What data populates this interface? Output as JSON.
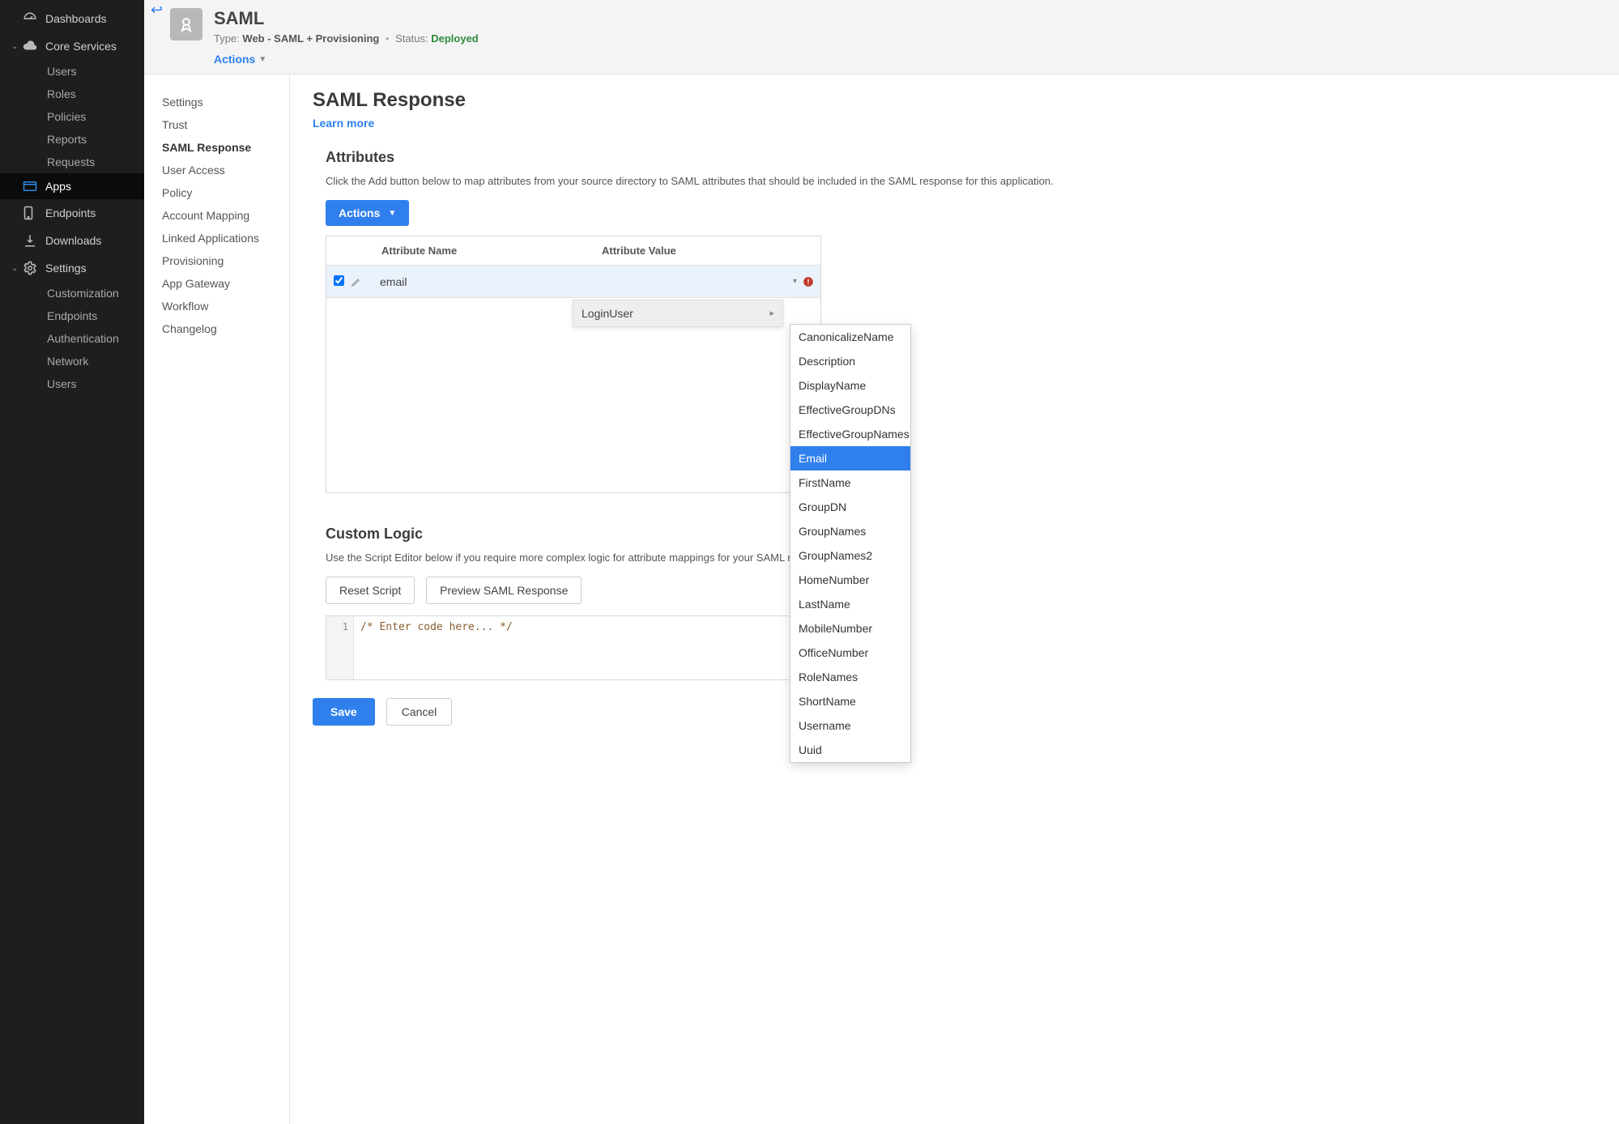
{
  "nav": {
    "dashboards": "Dashboards",
    "core_services": "Core Services",
    "core_items": [
      "Users",
      "Roles",
      "Policies",
      "Reports",
      "Requests"
    ],
    "apps": "Apps",
    "endpoints": "Endpoints",
    "downloads": "Downloads",
    "settings": "Settings",
    "settings_items": [
      "Customization",
      "Endpoints",
      "Authentication",
      "Network",
      "Users"
    ]
  },
  "header": {
    "title": "SAML",
    "type_label": "Type:",
    "type_value": "Web - SAML + Provisioning",
    "status_label": "Status:",
    "status_value": "Deployed",
    "actions": "Actions"
  },
  "sec_nav": [
    "Settings",
    "Trust",
    "SAML Response",
    "User Access",
    "Policy",
    "Account Mapping",
    "Linked Applications",
    "Provisioning",
    "App Gateway",
    "Workflow",
    "Changelog"
  ],
  "sec_nav_active": 2,
  "page": {
    "title": "SAML Response",
    "learn_more": "Learn more",
    "attributes_heading": "Attributes",
    "attributes_desc": "Click the Add button below to map attributes from your source directory to SAML attributes that should be included in the SAML response for this application.",
    "actions_btn": "Actions",
    "table": {
      "col_name": "Attribute Name",
      "col_value": "Attribute Value",
      "row_name": "email"
    },
    "dropdown": {
      "parent": "LoginUser",
      "options": [
        "CanonicalizeName",
        "Description",
        "DisplayName",
        "EffectiveGroupDNs",
        "EffectiveGroupNames",
        "Email",
        "FirstName",
        "GroupDN",
        "GroupNames",
        "GroupNames2",
        "HomeNumber",
        "LastName",
        "MobileNumber",
        "OfficeNumber",
        "RoleNames",
        "ShortName",
        "Username",
        "Uuid"
      ],
      "selected": "Email"
    },
    "custom_heading": "Custom Logic",
    "custom_desc": "Use the Script Editor below if you require more complex logic for attribute mappings for your SAML response.",
    "reset_btn": "Reset Script",
    "preview_btn": "Preview SAML Response",
    "code_line_no": "1",
    "code_text": "/* Enter code here... */",
    "save": "Save",
    "cancel": "Cancel"
  }
}
